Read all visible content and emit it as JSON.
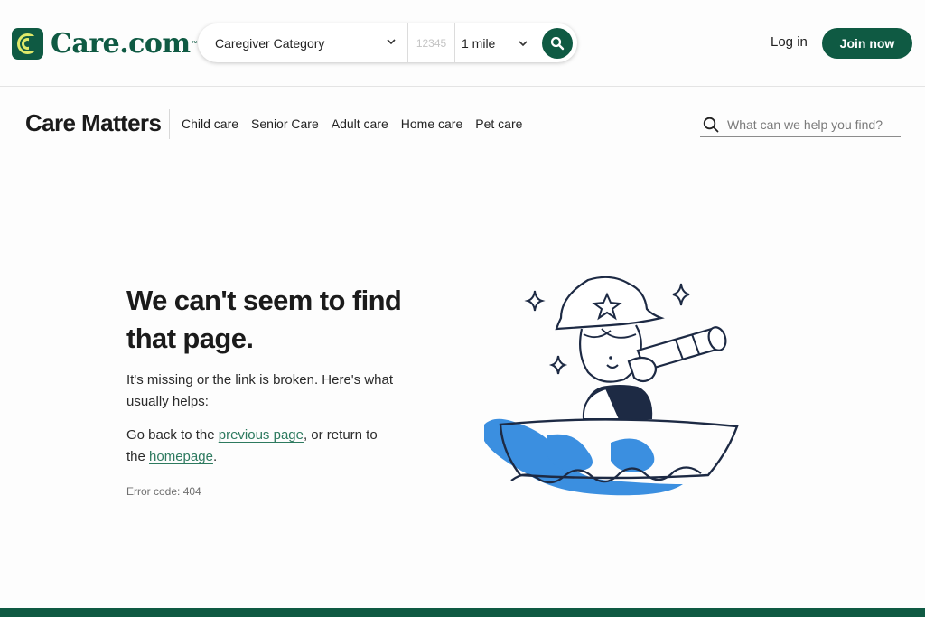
{
  "header": {
    "logo_text": "Care.com",
    "logo_tm": "™",
    "search": {
      "category_value": "Caregiver Category",
      "zip_placeholder": "12345",
      "distance_value": "1 mile"
    },
    "login_label": "Log in",
    "join_label": "Join now"
  },
  "subnav": {
    "brand": "Care Matters",
    "items": [
      "Child care",
      "Senior Care",
      "Adult care",
      "Home care",
      "Pet care"
    ],
    "search_placeholder": "What can we help you find?"
  },
  "main": {
    "heading": "We can't seem to find that page.",
    "missing_text": "It's missing or the link is broken. Here's what usually helps:",
    "go_back_prefix": "Go back to the ",
    "previous_page_link": "previous page",
    "return_middle": ", or return to the ",
    "homepage_link": "homepage",
    "suffix": ".",
    "error_code": "Error code: 404"
  },
  "colors": {
    "brand_green": "#0f5a43",
    "link_green": "#2d7a5f",
    "water_blue": "#3b8fe0"
  },
  "icons": [
    "care-logo-icon",
    "chevron-down-icon",
    "search-icon",
    "pirate-telescope-illustration"
  ]
}
